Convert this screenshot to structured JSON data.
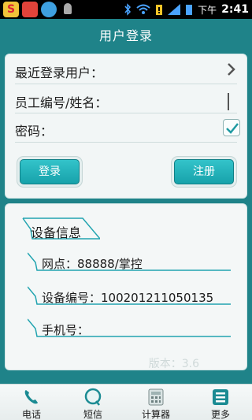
{
  "status_bar": {
    "ampm": "下午",
    "time": "2:41",
    "app_icons": [
      "sougou-input-icon",
      "app-red-icon",
      "weather-icon",
      "android-icon"
    ],
    "indicators": [
      "bluetooth-icon",
      "wifi-icon",
      "battery-alert-icon",
      "signal-icon",
      "battery-icon"
    ]
  },
  "header": {
    "title": "用户登录"
  },
  "login": {
    "recent_user_label": "最近登录用户：",
    "employee_label": "员工编号/姓名：",
    "password_label": "密码：",
    "remember_checked": true,
    "login_button": "登录",
    "register_button": "注册"
  },
  "device_info": {
    "title": "设备信息",
    "branch": "网点：88888/掌控",
    "device_no": "设备编号：100201211050135",
    "phone": "手机号：",
    "version": "版本：3.6"
  },
  "tabs": [
    {
      "label": "电话",
      "icon": "phone-icon"
    },
    {
      "label": "短信",
      "icon": "sms-icon"
    },
    {
      "label": "计算器",
      "icon": "calculator-icon"
    },
    {
      "label": "更多",
      "icon": "more-icon"
    }
  ],
  "colors": {
    "accent": "#1f8389",
    "button": "#17a2aa"
  }
}
